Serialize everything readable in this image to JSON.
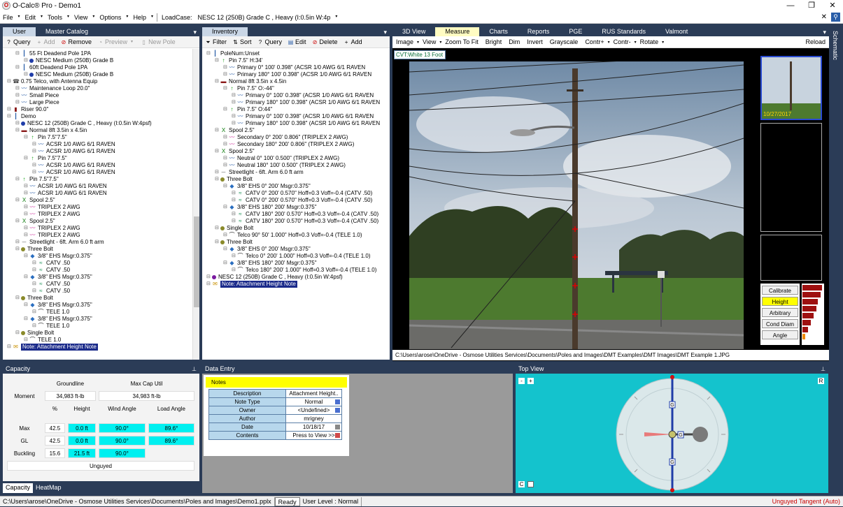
{
  "app": {
    "title": "O-Calc® Pro - Demo1",
    "icon": "ocalc-app-icon"
  },
  "window_controls": {
    "minimize": "—",
    "maximize": "❐",
    "close": "✕"
  },
  "menu": {
    "items": [
      "File",
      "Edit",
      "Tools",
      "View",
      "Options",
      "Help"
    ],
    "loadcase_label": "LoadCase:",
    "loadcase_value": "NESC  12 (250B) Grade C , Heavy (I:0.5in W:4p",
    "right_x": "✕"
  },
  "left_panel": {
    "tabs": [
      "User",
      "Master Catalog"
    ],
    "toolbar": [
      "Query",
      "Add",
      "Remove",
      "Preview",
      "New Pole"
    ],
    "tree": [
      {
        "indent": 1,
        "icon": "pole",
        "text": "55 Ft Deadend Pole 1PA"
      },
      {
        "indent": 2,
        "icon": "dot-blue",
        "text": "NESC Medium (250B) Grade B"
      },
      {
        "indent": 1,
        "icon": "pole",
        "text": "60ft Deadend Pole 1PA"
      },
      {
        "indent": 2,
        "icon": "dot-blue",
        "text": "NESC Medium (250B) Grade B"
      },
      {
        "indent": 0,
        "icon": "telco",
        "text": "0.75 Telco, with Antenna Equip"
      },
      {
        "indent": 1,
        "icon": "wire",
        "text": "Maintenance Loop 20.0\""
      },
      {
        "indent": 1,
        "icon": "wire",
        "text": "Small Piece"
      },
      {
        "indent": 1,
        "icon": "wire",
        "text": "Large Piece"
      },
      {
        "indent": 0,
        "icon": "riser",
        "text": "Riser 90.0\""
      },
      {
        "indent": 0,
        "icon": "pole",
        "text": "Demo"
      },
      {
        "indent": 1,
        "icon": "dot-blue",
        "text": "NESC  12 (250B) Grade C , Heavy (I:0.5in W:4psf)"
      },
      {
        "indent": 1,
        "icon": "crossarm",
        "text": "Normal 8ft  3.5in x 4.5in"
      },
      {
        "indent": 2,
        "icon": "pin",
        "text": "Pin 7.5\"7.5\""
      },
      {
        "indent": 3,
        "icon": "wire",
        "text": "ACSR 1/0  AWG 6/1 RAVEN"
      },
      {
        "indent": 3,
        "icon": "wire",
        "text": "ACSR 1/0  AWG 6/1 RAVEN"
      },
      {
        "indent": 2,
        "icon": "pin",
        "text": "Pin 7.5\"7.5\""
      },
      {
        "indent": 3,
        "icon": "wire",
        "text": "ACSR 1/0  AWG 6/1 RAVEN"
      },
      {
        "indent": 3,
        "icon": "wire",
        "text": "ACSR 1/0  AWG 6/1 RAVEN"
      },
      {
        "indent": 1,
        "icon": "pin",
        "text": "Pin 7.5\"7.5\""
      },
      {
        "indent": 2,
        "icon": "wire",
        "text": "ACSR 1/0  AWG 6/1 RAVEN"
      },
      {
        "indent": 2,
        "icon": "wire",
        "text": "ACSR 1/0  AWG 6/1 RAVEN"
      },
      {
        "indent": 1,
        "icon": "spool",
        "text": "Spool 2.5\""
      },
      {
        "indent": 2,
        "icon": "wire-pink",
        "text": "TRIPLEX 2 AWG"
      },
      {
        "indent": 2,
        "icon": "wire-pink",
        "text": "TRIPLEX 2 AWG"
      },
      {
        "indent": 1,
        "icon": "spool",
        "text": "Spool 2.5\""
      },
      {
        "indent": 2,
        "icon": "wire-pink",
        "text": "TRIPLEX 2 AWG"
      },
      {
        "indent": 2,
        "icon": "wire-pink",
        "text": "TRIPLEX 2 AWG"
      },
      {
        "indent": 1,
        "icon": "streetlight",
        "text": "Streetlight - 6ft. Arm 6.0 ft arm"
      },
      {
        "indent": 1,
        "icon": "bolt",
        "text": "Three Bolt"
      },
      {
        "indent": 2,
        "icon": "ehs",
        "text": "3/8\" EHS  Msgr:0.375\""
      },
      {
        "indent": 3,
        "icon": "catv",
        "text": "CATV .50"
      },
      {
        "indent": 3,
        "icon": "catv",
        "text": "CATV .50"
      },
      {
        "indent": 2,
        "icon": "ehs",
        "text": "3/8\" EHS  Msgr:0.375\""
      },
      {
        "indent": 3,
        "icon": "catv",
        "text": "CATV .50"
      },
      {
        "indent": 3,
        "icon": "catv",
        "text": "CATV .50"
      },
      {
        "indent": 1,
        "icon": "bolt",
        "text": "Three Bolt"
      },
      {
        "indent": 2,
        "icon": "ehs",
        "text": "3/8\" EHS  Msgr:0.375\""
      },
      {
        "indent": 3,
        "icon": "tele",
        "text": "TELE 1.0"
      },
      {
        "indent": 2,
        "icon": "ehs",
        "text": "3/8\" EHS  Msgr:0.375\""
      },
      {
        "indent": 3,
        "icon": "tele",
        "text": "TELE 1.0"
      },
      {
        "indent": 1,
        "icon": "bolt",
        "text": "Single Bolt"
      },
      {
        "indent": 2,
        "icon": "tele",
        "text": "TELE 1.0"
      },
      {
        "indent": 0,
        "icon": "note",
        "text": "Note: Attachment Height Note",
        "selected": true
      }
    ]
  },
  "inventory_panel": {
    "tabs": [
      "Inventory"
    ],
    "toolbar": [
      "Filter",
      "Sort",
      "Query",
      "Edit",
      "Delete",
      "Add"
    ],
    "tree": [
      {
        "indent": 0,
        "icon": "pole",
        "text": "PoleNum:Unset"
      },
      {
        "indent": 1,
        "icon": "pin",
        "text": "Pin 7.5\" H:34'"
      },
      {
        "indent": 2,
        "icon": "wire",
        "text": "Primary 0° 100' 0.398\"  (ACSR 1/0  AWG 6/1 RAVEN"
      },
      {
        "indent": 2,
        "icon": "wire",
        "text": "Primary 180° 100' 0.398\"  (ACSR 1/0  AWG 6/1 RAVEN"
      },
      {
        "indent": 1,
        "icon": "crossarm",
        "text": "Normal 8ft  3.5in x 4.5in"
      },
      {
        "indent": 2,
        "icon": "pin",
        "text": "Pin 7.5\" O:-44\""
      },
      {
        "indent": 3,
        "icon": "wire",
        "text": "Primary 0° 100' 0.398\"  (ACSR 1/0  AWG 6/1 RAVEN"
      },
      {
        "indent": 3,
        "icon": "wire",
        "text": "Primary 180° 100' 0.398\"  (ACSR 1/0  AWG 6/1 RAVEN"
      },
      {
        "indent": 2,
        "icon": "pin",
        "text": "Pin 7.5\" O:44\""
      },
      {
        "indent": 3,
        "icon": "wire",
        "text": "Primary 0° 100' 0.398\"  (ACSR 1/0  AWG 6/1 RAVEN"
      },
      {
        "indent": 3,
        "icon": "wire",
        "text": "Primary 180° 100' 0.398\"  (ACSR 1/0  AWG 6/1 RAVEN"
      },
      {
        "indent": 1,
        "icon": "spool",
        "text": "Spool 2.5\""
      },
      {
        "indent": 2,
        "icon": "wire-pink",
        "text": "Secondary 0° 200' 0.806\"  (TRIPLEX 2 AWG)"
      },
      {
        "indent": 2,
        "icon": "wire-pink",
        "text": "Secondary 180° 200' 0.806\"  (TRIPLEX 2 AWG)"
      },
      {
        "indent": 1,
        "icon": "spool",
        "text": "Spool 2.5\""
      },
      {
        "indent": 2,
        "icon": "wire",
        "text": "Neutral 0° 100' 0.500\"  (TRIPLEX 2 AWG)"
      },
      {
        "indent": 2,
        "icon": "wire",
        "text": "Neutral 180° 100' 0.500\"  (TRIPLEX 2 AWG)"
      },
      {
        "indent": 1,
        "icon": "streetlight",
        "text": "Streetlight - 6ft. Arm 6.0 ft arm"
      },
      {
        "indent": 1,
        "icon": "bolt",
        "text": "Three Bolt"
      },
      {
        "indent": 2,
        "icon": "ehs",
        "text": "3/8\" EHS 0° 200'  Msgr:0.375\""
      },
      {
        "indent": 3,
        "icon": "catv",
        "text": "CATV 0° 200' 0.570\" Hoff=0.3 Voff=-0.4  (CATV .50)"
      },
      {
        "indent": 3,
        "icon": "catv",
        "text": "CATV 0° 200' 0.570\" Hoff=0.3 Voff=-0.4  (CATV .50)"
      },
      {
        "indent": 2,
        "icon": "ehs",
        "text": "3/8\" EHS 180° 200'  Msgr:0.375\""
      },
      {
        "indent": 3,
        "icon": "catv",
        "text": "CATV 180° 200' 0.570\" Hoff=0.3 Voff=-0.4  (CATV .50)"
      },
      {
        "indent": 3,
        "icon": "catv",
        "text": "CATV 180° 200' 0.570\" Hoff=0.3 Voff=-0.4  (CATV .50)"
      },
      {
        "indent": 1,
        "icon": "bolt",
        "text": "Single Bolt"
      },
      {
        "indent": 2,
        "icon": "tele",
        "text": "Telco 90° 50' 1.000\" Hoff=0.3 Voff=-0.4  (TELE 1.0)"
      },
      {
        "indent": 1,
        "icon": "bolt",
        "text": "Three Bolt"
      },
      {
        "indent": 2,
        "icon": "ehs",
        "text": "3/8\" EHS 0° 200'  Msgr:0.375\""
      },
      {
        "indent": 3,
        "icon": "tele",
        "text": "Telco 0° 200' 1.000\" Hoff=0.3 Voff=-0.4  (TELE 1.0)"
      },
      {
        "indent": 2,
        "icon": "ehs",
        "text": "3/8\" EHS 180° 200'  Msgr:0.375\""
      },
      {
        "indent": 3,
        "icon": "tele",
        "text": "Telco 180° 200' 1.000\" Hoff=0.3 Voff=-0.4  (TELE 1.0)"
      },
      {
        "indent": 0,
        "icon": "loadcase",
        "text": "NESC  12 (250B) Grade C , Heavy (I:0.5in W:4psf)"
      },
      {
        "indent": 0,
        "icon": "note",
        "text": "Note: Attachment Height Note",
        "selected": true
      }
    ]
  },
  "right_panel": {
    "tabs": [
      "3D View",
      "Measure",
      "Charts",
      "Reports",
      "PGE",
      "RUS Standards",
      "Valmont"
    ],
    "active_tab": "Measure",
    "toolbar": [
      "Image",
      "View",
      "Zoom To Fit",
      "Bright",
      "Dim",
      "Invert",
      "Grayscale",
      "Contr+",
      "Contr-",
      "Rotate",
      "Reload"
    ],
    "cvt_label": "CVT:White 13 Foot",
    "thumb_date": "10/27/2017",
    "measure_buttons": [
      "Calibrate",
      "Height",
      "Arbitrary",
      "Cond Diam",
      "Angle"
    ],
    "active_measure": "Height",
    "image_path": "C:\\Users\\arose\\OneDrive - Osmose Utilities Services\\Documents\\Poles and Images\\DMT Examples\\DMT Images\\DMT Example 1.JPG",
    "side_tab": "Schematic"
  },
  "capacity": {
    "header": "Capacity",
    "col_groundline": "Groundline",
    "col_maxcap": "Max Cap Util",
    "moment_label": "Moment",
    "moment_groundline": "34,983 ft-lb",
    "moment_maxcap": "34,983 ft-lb",
    "col_pct": "%",
    "col_height": "Height",
    "col_wind": "Wind Angle",
    "col_load": "Load Angle",
    "rows": [
      {
        "label": "Max",
        "pct": "42.5",
        "height": "0.0 ft",
        "wind": "90.0°",
        "load": "89.6°"
      },
      {
        "label": "GL",
        "pct": "42.5",
        "height": "0.0 ft",
        "wind": "90.0°",
        "load": "89.6°"
      },
      {
        "label": "Buckling",
        "pct": "15.6",
        "height": "21.5 ft",
        "wind": "90.0°",
        "load": ""
      }
    ],
    "guy_status": "Unguyed",
    "tabs": [
      "Capacity",
      "HeatMap"
    ]
  },
  "data_entry": {
    "header": "Data Entry",
    "notes_title": "Notes",
    "fields": [
      {
        "label": "Description",
        "value": "Attachment  Height..",
        "btn": ""
      },
      {
        "label": "Note Type",
        "value": "Normal",
        "btn": "blue"
      },
      {
        "label": "Owner",
        "value": "<Undefined>",
        "btn": "blue"
      },
      {
        "label": "Author",
        "value": "mrigney",
        "btn": ""
      },
      {
        "label": "Date",
        "value": "10/18/17",
        "btn": "grey"
      },
      {
        "label": "Contents",
        "value": "Press to View >>",
        "btn": "red"
      }
    ]
  },
  "top_view": {
    "header": "Top View",
    "minus": "-",
    "plus": "+",
    "r_btn": "R",
    "c_btn": "C",
    "g_label": "G"
  },
  "status": {
    "path": "C:\\Users\\arose\\OneDrive - Osmose Utilities Services\\Documents\\Poles and Images\\Demo1.pplx",
    "ready": "Ready",
    "user_level": "User Level : Normal",
    "tangent": "Unguyed Tangent (Auto)"
  },
  "colors": {
    "accent_dark": "#2b3c57",
    "cyan": "#00f0f0",
    "tab_active": "#fffcc2",
    "sel": "#1a2a8a",
    "notes_yellow": "#ffff00"
  }
}
